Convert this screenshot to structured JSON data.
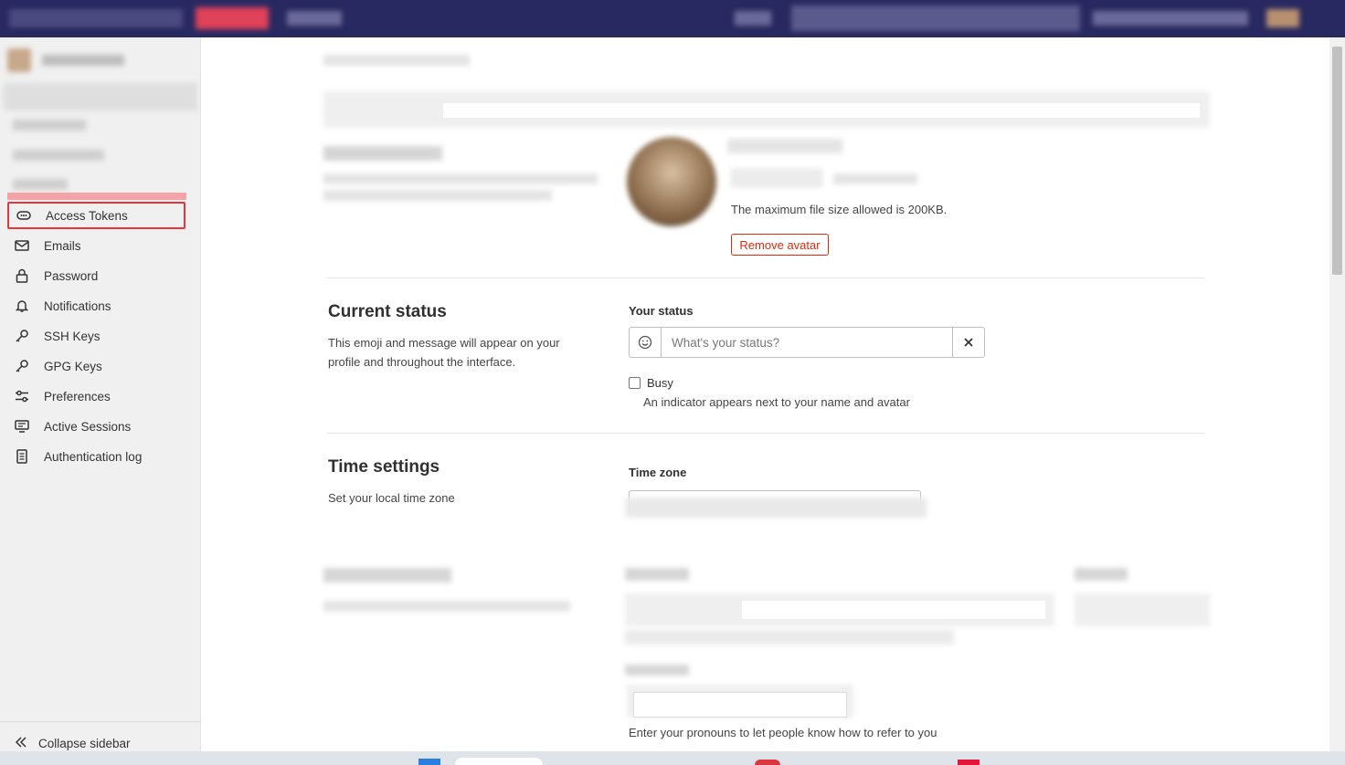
{
  "sidebar": {
    "items": [
      {
        "label": "Access Tokens",
        "icon": "token-icon"
      },
      {
        "label": "Emails",
        "icon": "mail-icon"
      },
      {
        "label": "Password",
        "icon": "lock-icon"
      },
      {
        "label": "Notifications",
        "icon": "bell-icon"
      },
      {
        "label": "SSH Keys",
        "icon": "key-icon"
      },
      {
        "label": "GPG Keys",
        "icon": "key-icon"
      },
      {
        "label": "Preferences",
        "icon": "preferences-icon"
      },
      {
        "label": "Active Sessions",
        "icon": "monitor-icon"
      },
      {
        "label": "Authentication log",
        "icon": "log-icon"
      }
    ],
    "collapse_label": "Collapse sidebar"
  },
  "avatar": {
    "max_size_text": "The maximum file size allowed is 200KB.",
    "remove_label": "Remove avatar"
  },
  "status": {
    "title": "Current status",
    "description": "This emoji and message will appear on your profile and throughout the interface.",
    "your_status_label": "Your status",
    "placeholder": "What's your status?",
    "busy_label": "Busy",
    "busy_help": "An indicator appears next to your name and avatar"
  },
  "time": {
    "title": "Time settings",
    "description": "Set your local time zone",
    "zone_label": "Time zone"
  },
  "pronouns": {
    "help": "Enter your pronouns to let people know how to refer to you"
  },
  "colors": {
    "topbar": "#292961",
    "highlight": "#e8343b",
    "danger": "#dd2b0e"
  }
}
